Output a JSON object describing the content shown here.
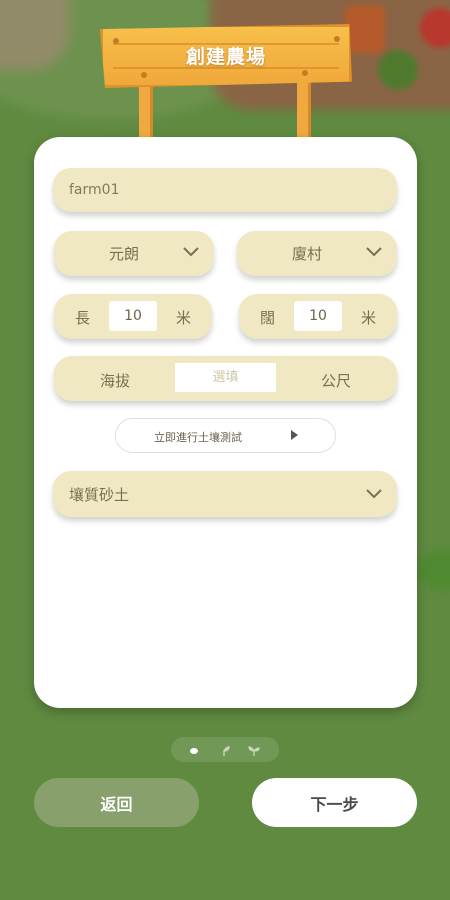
{
  "header": {
    "title": "創建農場"
  },
  "form": {
    "farm_name": "farm01",
    "region": "元朗",
    "village": "廈村",
    "length": {
      "label": "長",
      "value": "10",
      "unit": "米"
    },
    "width": {
      "label": "闊",
      "value": "10",
      "unit": "米"
    },
    "altitude": {
      "label": "海拔",
      "placeholder": "選填",
      "unit": "公尺"
    },
    "soil_test_label": "立即進行土壤測試",
    "soil_type": "壤質砂土"
  },
  "pager": {
    "current_step": 1,
    "total_steps": 3
  },
  "footer": {
    "back_label": "返回",
    "next_label": "下一步"
  },
  "colors": {
    "background": "#5f8a40",
    "field": "#efe8c3",
    "sign": "#f0a83a",
    "back_button": "#87a06c"
  }
}
